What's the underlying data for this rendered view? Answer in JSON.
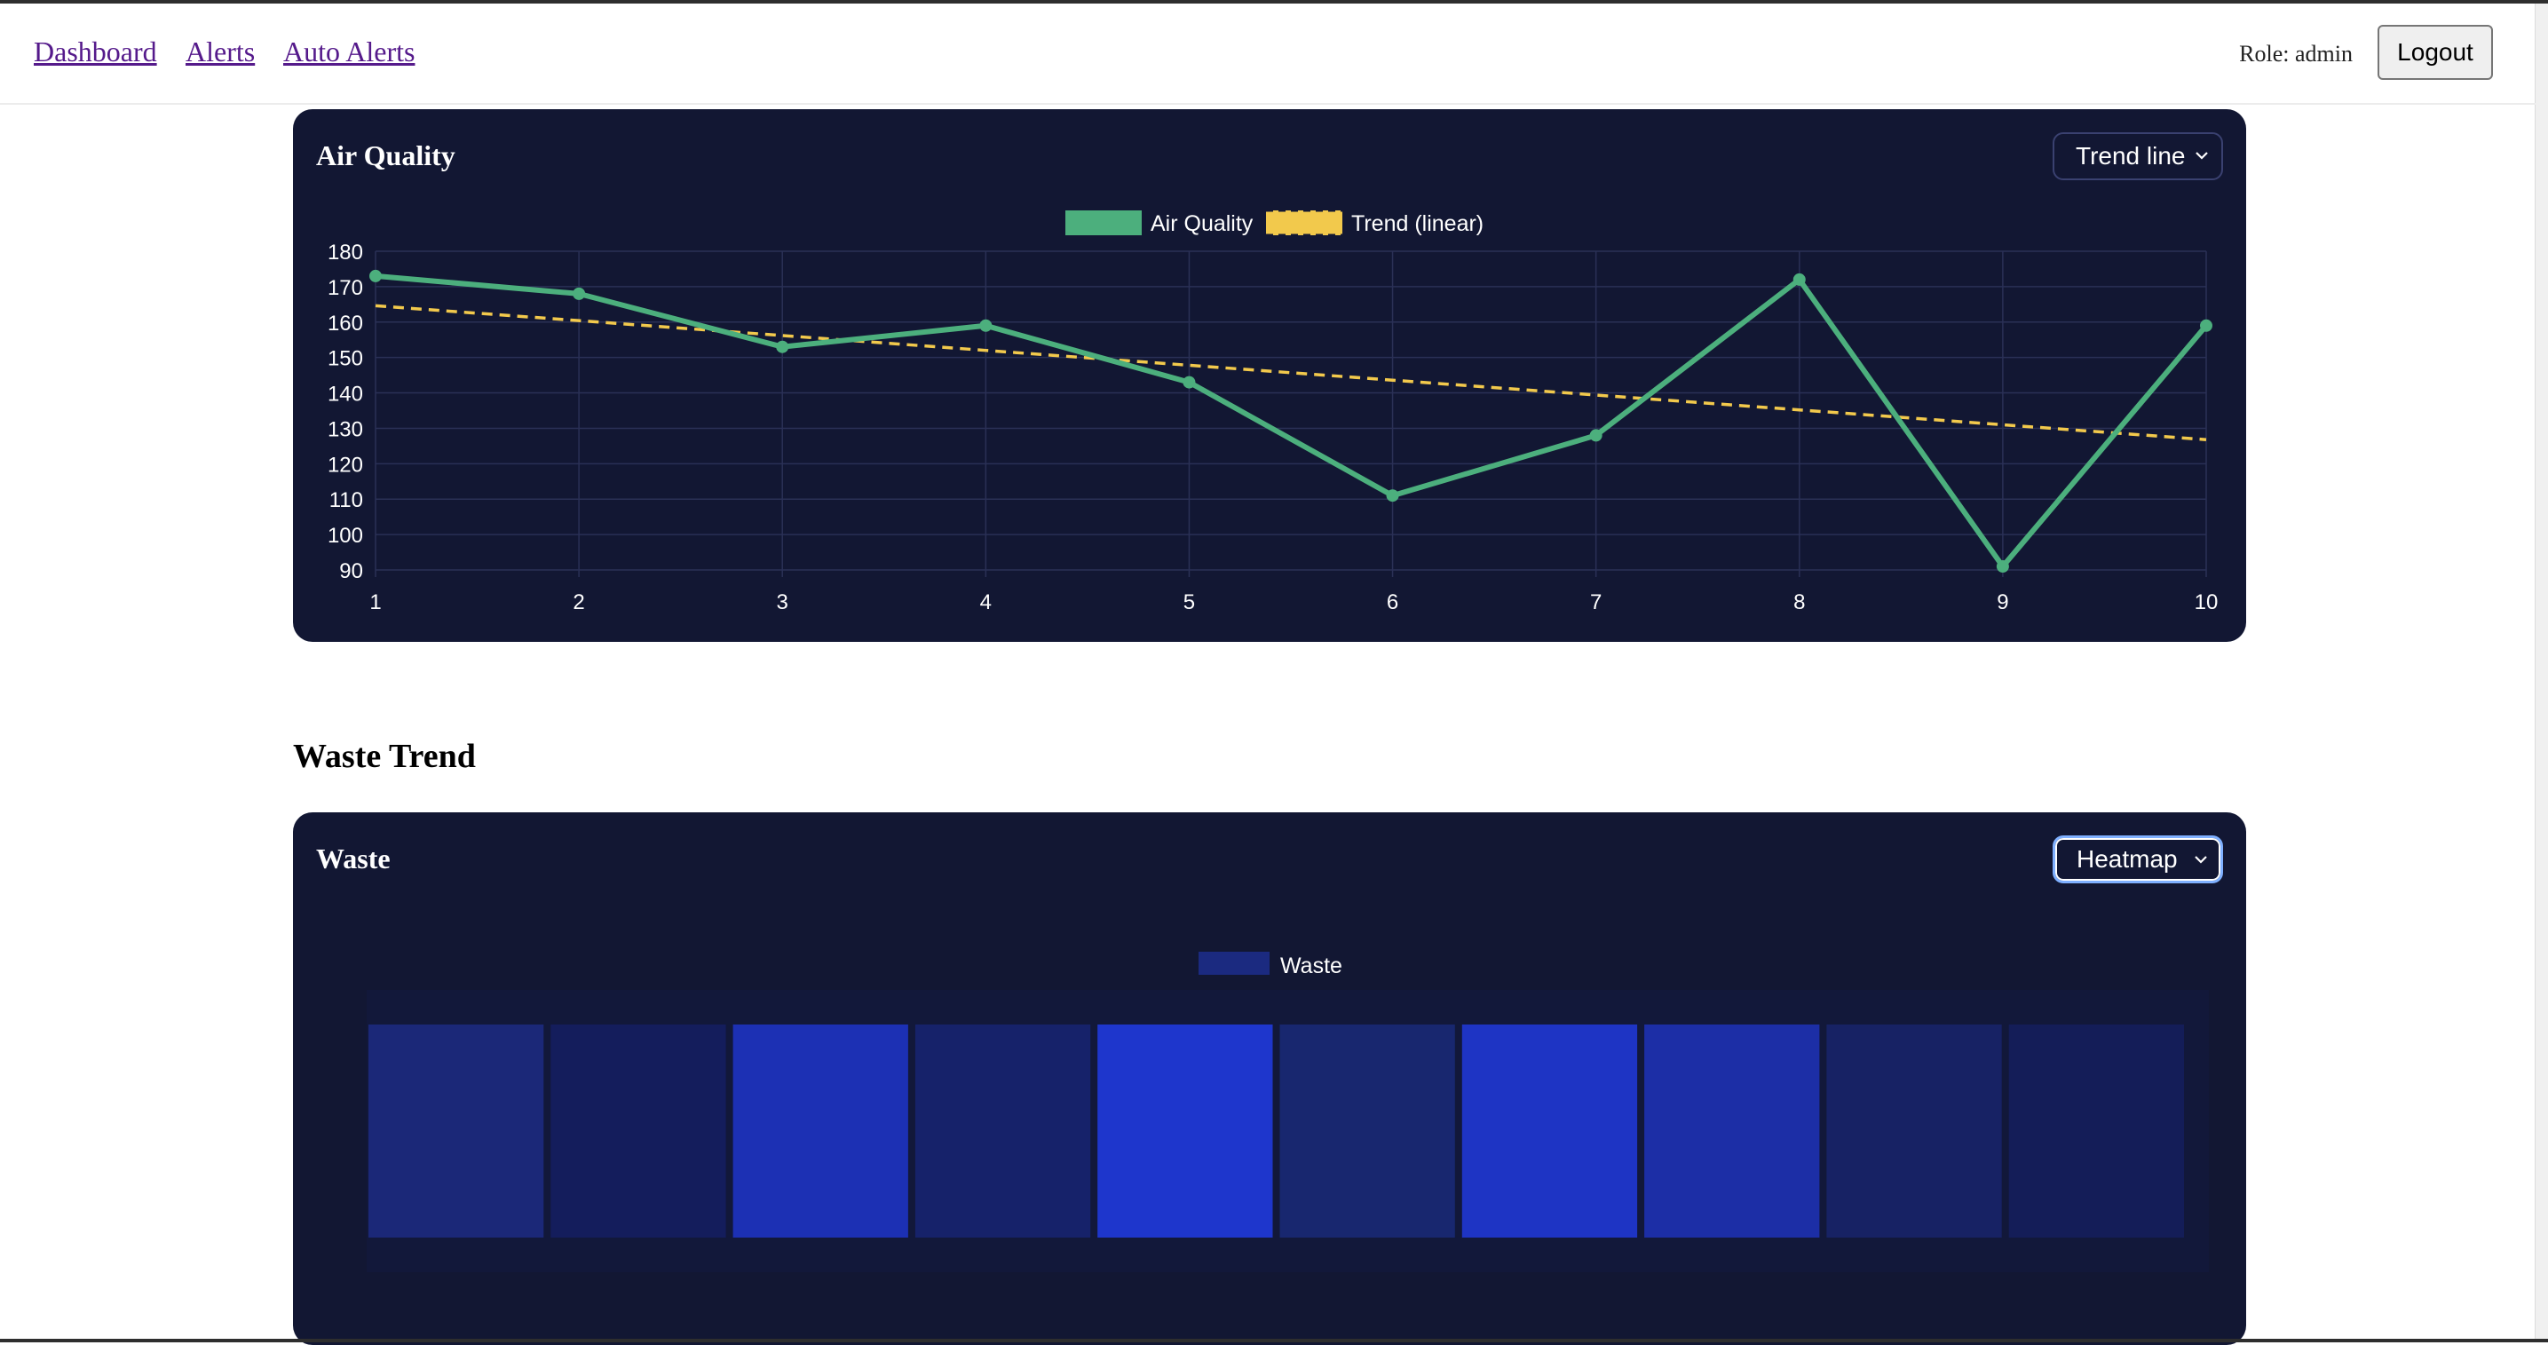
{
  "nav": {
    "links": [
      "Dashboard",
      "Alerts",
      "Auto Alerts"
    ],
    "role_text": "Role: admin",
    "logout_label": "Logout"
  },
  "air_card": {
    "title": "Air Quality",
    "select_value": "Trend line",
    "legend": [
      "Air Quality",
      "Trend (linear)"
    ],
    "colors": {
      "series": "#4caf7d",
      "trend": "#f2c94c",
      "background": "#121733",
      "grid": "#2a3056"
    }
  },
  "waste_section": {
    "heading": "Waste Trend",
    "title": "Waste",
    "select_value": "Heatmap",
    "legend": [
      "Waste"
    ],
    "colors": [
      "#1b2878",
      "#141d5c",
      "#1c30b4",
      "#16226a",
      "#1e36cc",
      "#18276f",
      "#1e34c4",
      "#1c2ea6",
      "#172264",
      "#141d58"
    ]
  },
  "chart_data": [
    {
      "type": "line",
      "x": [
        1,
        2,
        3,
        4,
        5,
        6,
        7,
        8,
        9,
        10
      ],
      "series": [
        {
          "name": "Air Quality",
          "values": [
            173,
            168,
            153,
            159,
            143,
            111,
            128,
            172,
            91,
            159
          ]
        },
        {
          "name": "Trend (linear)",
          "values": [
            164.6,
            160.4,
            156.2,
            152.0,
            147.8,
            143.6,
            139.4,
            135.2,
            131.0,
            126.8
          ]
        }
      ],
      "ylim": [
        90,
        180
      ],
      "yticks": [
        180,
        170,
        160,
        150,
        140,
        130,
        120,
        110,
        100,
        90
      ],
      "xticks": [
        1,
        2,
        3,
        4,
        5,
        6,
        7,
        8,
        9,
        10
      ],
      "grid": true,
      "legend": "top-center"
    },
    {
      "type": "heatmap",
      "series": [
        {
          "name": "Waste",
          "values": [
            3,
            1,
            7,
            2,
            9,
            3,
            8,
            6,
            2,
            1
          ]
        }
      ],
      "legend": "top-center"
    }
  ]
}
